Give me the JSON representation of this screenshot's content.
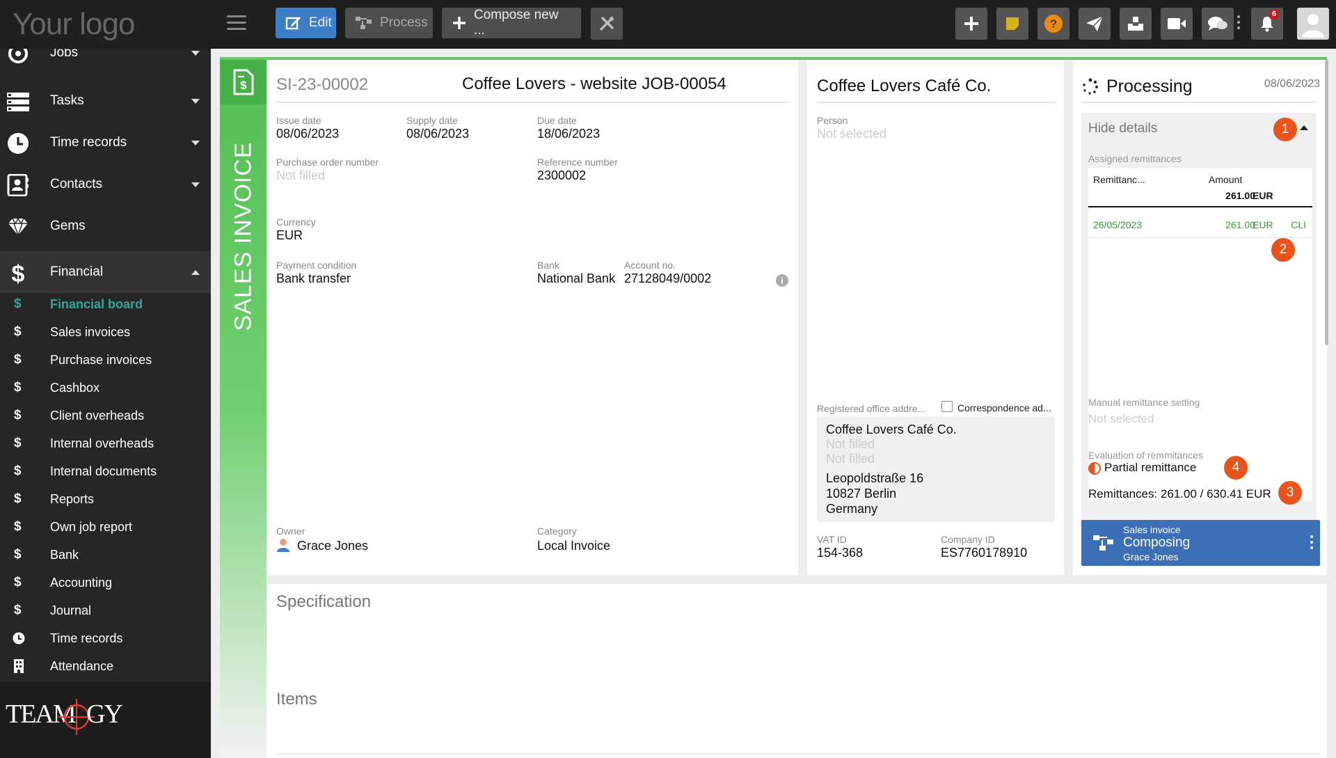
{
  "topbar": {
    "logo": "Your logo",
    "edit_label": "Edit",
    "process_label": "Process",
    "compose_label": "Compose new ...",
    "notification_count": "6"
  },
  "sidebar": {
    "items": [
      {
        "label": "Jobs"
      },
      {
        "label": "Tasks"
      },
      {
        "label": "Time records"
      },
      {
        "label": "Contacts"
      },
      {
        "label": "Gems"
      },
      {
        "label": "Financial"
      }
    ],
    "financial_sub": [
      {
        "label": "Financial board",
        "active": true
      },
      {
        "label": "Sales invoices"
      },
      {
        "label": "Purchase invoices"
      },
      {
        "label": "Cashbox"
      },
      {
        "label": "Client overheads"
      },
      {
        "label": "Internal overheads"
      },
      {
        "label": "Internal documents"
      },
      {
        "label": "Reports"
      },
      {
        "label": "Own job report"
      },
      {
        "label": "Bank"
      },
      {
        "label": "Accounting"
      },
      {
        "label": "Journal"
      },
      {
        "label": "Time records"
      },
      {
        "label": "Attendance"
      }
    ],
    "brand": "TEAMOGY",
    "colors": {
      "accent": "#2fa89a",
      "background": "#262626"
    }
  },
  "invoice": {
    "side_label": "SALES INVOICE",
    "number": "SI-23-00002",
    "title": "Coffee Lovers - website JOB-00054",
    "issue_date_label": "Issue date",
    "issue_date": "08/06/2023",
    "supply_date_label": "Supply date",
    "supply_date": "08/06/2023",
    "due_date_label": "Due date",
    "due_date": "18/06/2023",
    "po_label": "Purchase order number",
    "po_value": "Not filled",
    "ref_label": "Reference number",
    "ref_value": "2300002",
    "currency_label": "Currency",
    "currency_value": "EUR",
    "payment_label": "Payment condition",
    "payment_value": "Bank transfer",
    "bank_label": "Bank",
    "bank_value": "National Bank",
    "account_label": "Account no.",
    "account_value": "27128049/0002",
    "owner_label": "Owner",
    "owner_value": "Grace Jones",
    "category_label": "Category",
    "category_value": "Local Invoice",
    "colors": {
      "side_bar": "#6fcf6f"
    }
  },
  "client": {
    "name": "Coffee Lovers Café Co.",
    "person_label": "Person",
    "person_value": "Not selected",
    "office_label": "Registered office addre...",
    "correspondence_label": "Correspondence ad...",
    "address": {
      "company": "Coffee Lovers Café Co.",
      "line1": "Not filled",
      "line2": "Not filled",
      "street": "Leopoldstraße 16",
      "city": "10827 Berlin",
      "country": "Germany"
    },
    "vat_label": "VAT ID",
    "vat_value": "154-368",
    "company_id_label": "Company ID",
    "company_id_value": "ES7760178910"
  },
  "processing": {
    "title": "Processing",
    "date": "08/06/2023",
    "hide_details": "Hide details",
    "assigned_label": "Assigned remittances",
    "col_remittance": "Remittanc...",
    "col_amount": "Amount",
    "total_amount": "261.00",
    "total_currency": "EUR",
    "rows": [
      {
        "date": "26/05/2023",
        "amount": "261.00",
        "currency": "EUR",
        "code": "CLI"
      }
    ],
    "manual_label": "Manual remittance setting",
    "manual_value": "Not selected",
    "evaluation_label": "Evaluation of remmitances",
    "evaluation_value": "Partial remittance",
    "summary": "Remittances: 261.00 / 630.41 EUR",
    "badges": [
      "1",
      "2",
      "3",
      "4"
    ],
    "workflow": {
      "type": "Sales invoice",
      "state": "Composing",
      "user": "Grace Jones",
      "color": "#3d6fb6"
    },
    "colors": {
      "green_text": "#2ca52c",
      "badge": "#e8541c"
    }
  },
  "bottom": {
    "specification": "Specification",
    "items": "Items"
  }
}
